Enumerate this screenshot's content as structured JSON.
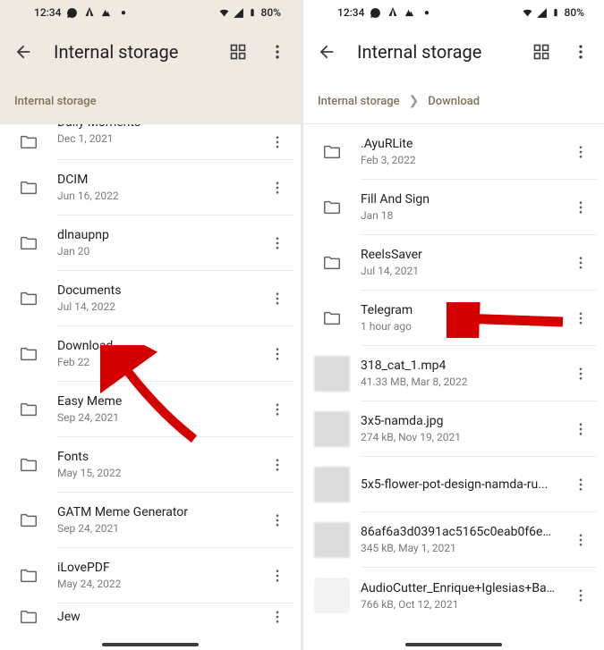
{
  "status": {
    "time": "12:34",
    "battery": "80%"
  },
  "left": {
    "title": "Internal storage",
    "breadcrumb": [
      "Internal storage"
    ],
    "items": [
      {
        "name": "Daily Moments",
        "meta": "Dec 1, 2021",
        "type": "folder",
        "cut": true
      },
      {
        "name": "DCIM",
        "meta": "Jun 16, 2022",
        "type": "folder"
      },
      {
        "name": "dlnaupnp",
        "meta": "Jan 20",
        "type": "folder"
      },
      {
        "name": "Documents",
        "meta": "Jul 14, 2022",
        "type": "folder"
      },
      {
        "name": "Download",
        "meta": "Feb 22",
        "type": "folder"
      },
      {
        "name": "Easy Meme",
        "meta": "Sep 24, 2021",
        "type": "folder"
      },
      {
        "name": "Fonts",
        "meta": "May 15, 2022",
        "type": "folder"
      },
      {
        "name": "GATM Meme Generator",
        "meta": "Sep 24, 2021",
        "type": "folder"
      },
      {
        "name": "iLovePDF",
        "meta": "May 24, 2022",
        "type": "folder"
      },
      {
        "name": "Jew",
        "meta": "",
        "type": "folder",
        "cut_bottom": true
      }
    ]
  },
  "right": {
    "title": "Internal storage",
    "breadcrumb": [
      "Internal storage",
      "Download"
    ],
    "items": [
      {
        "name": ".AyuRLite",
        "meta": "Feb 3, 2022",
        "type": "folder"
      },
      {
        "name": "Fill And Sign",
        "meta": "Jan 18",
        "type": "folder"
      },
      {
        "name": "ReelsSaver",
        "meta": "Jul 14, 2021",
        "type": "folder"
      },
      {
        "name": "Telegram",
        "meta": "1 hour ago",
        "type": "folder"
      },
      {
        "name": "318_cat_1.mp4",
        "meta": "41.33 MB, Mar 8, 2022",
        "type": "thumb"
      },
      {
        "name": "3x5-namda.jpg",
        "meta": "274 kB, Nov 19, 2021",
        "type": "thumb"
      },
      {
        "name": "5x5-flower-pot-design-namda-ru...",
        "meta": "",
        "type": "thumb"
      },
      {
        "name": "86af6a3d0391ac5165c0eab0f6e3...",
        "meta": "345 kB, May 1, 2021",
        "type": "thumb"
      },
      {
        "name": "AudioCutter_Enrique+Iglesias+Bail...",
        "meta": "766 kB, Oct 12, 2021",
        "type": "file"
      }
    ]
  }
}
